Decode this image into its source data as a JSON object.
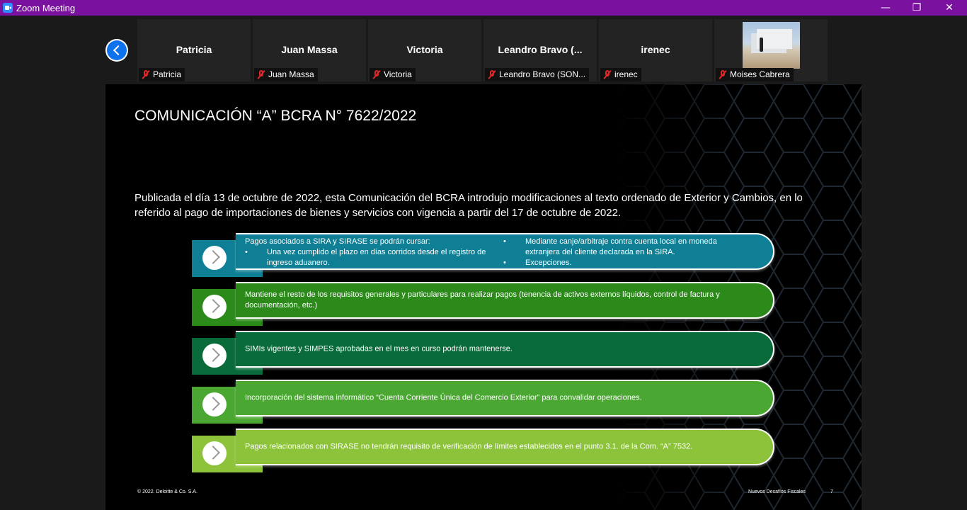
{
  "window": {
    "title": "Zoom Meeting",
    "min": "—",
    "max": "❐",
    "close": "✕"
  },
  "participants": [
    {
      "name": "Patricia",
      "label": "Patricia"
    },
    {
      "name": "Juan Massa",
      "label": "Juan Massa"
    },
    {
      "name": "Victoria",
      "label": "Victoria"
    },
    {
      "name": "Leandro  Bravo  (...",
      "label": "Leandro Bravo (SON..."
    },
    {
      "name": "irenec",
      "label": "irenec"
    },
    {
      "name": "",
      "label": "Moises Cabrera"
    }
  ],
  "slide": {
    "title": "COMUNICACIÓN “A” BCRA N° 7622/2022",
    "intro": "Publicada el día 13 de octubre de 2022, esta Comunicación del BCRA introdujo modificaciones al texto ordenado de Exterior y Cambios, en lo referido al pago de importaciones de bienes y servicios con vigencia a partir del 17 de octubre de 2022.",
    "row1": {
      "lead": "Pagos asociados a SIRA y SIRASE se podrán cursar:",
      "b1": "Una vez cumplido el plazo en días corridos desde el registro de ingreso aduanero.",
      "b2": "Mediante canje/arbitraje contra cuenta local en moneda extranjera del cliente declarada en la SIRA.",
      "b3": "Excepciones."
    },
    "row2": "Mantiene el resto de los requisitos generales y particulares para realizar pagos (tenencia de activos externos líquidos, control de factura y documentación, etc.)",
    "row3": "SIMIs vigentes y SIMPES aprobadas en el mes en curso podrán mantenerse.",
    "row4": "Incorporación del sistema informático “Cuenta Corriente Única del Comercio Exterior” para convalidar operaciones.",
    "row5": "Pagos relacionados con SIRASE no tendrán requisito de verificación de límites establecidos en el punto 3.1. de la Com. “A” 7532.",
    "footer_left": "© 2022. Deloitte & Co. S.A.",
    "footer_right": "Nuevos Desafíos Fiscales",
    "page": "7"
  },
  "colors": {
    "titlebar": "#7a119f",
    "row1": "#0f7f95",
    "row2": "#2b8a1a",
    "row3": "#0a6b3a",
    "row4": "#4aa832",
    "row5": "#8cc33a"
  }
}
